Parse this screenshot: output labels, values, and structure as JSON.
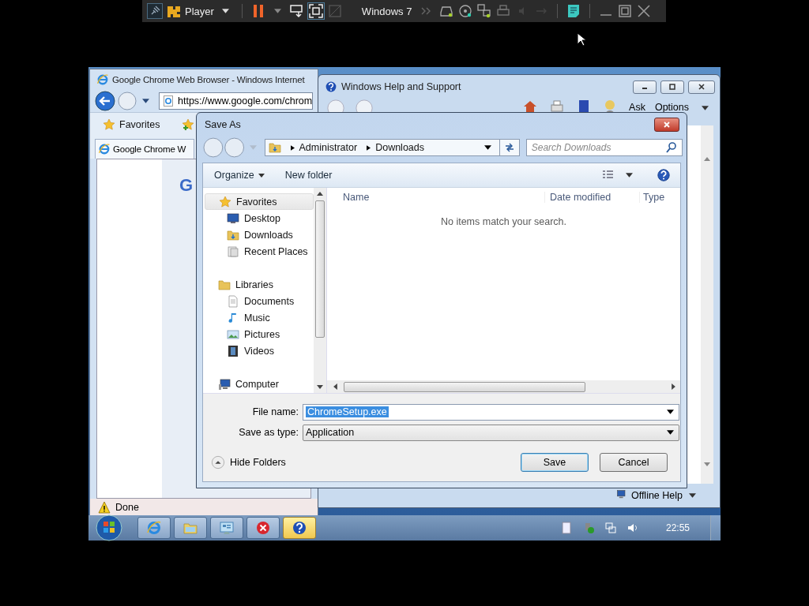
{
  "vm_toolbar": {
    "app_label": "Player",
    "vm_name": "Windows 7"
  },
  "browser_window": {
    "title": "Google Chrome Web Browser - Windows Internet",
    "address": "https://www.google.com/chrom",
    "favorites_label": "Favorites",
    "tab_label": "Google Chrome W",
    "page_text": "G",
    "status": "Done"
  },
  "help_window": {
    "title": "Windows Help and Support",
    "toolbar_labels": [
      "Ask",
      "Options"
    ],
    "footer_link": "Offline Help"
  },
  "save_dialog": {
    "title": "Save As",
    "breadcrumb": [
      "Administrator",
      "Downloads"
    ],
    "search": {
      "placeholder": "Search Downloads"
    },
    "toolbar": [
      "Organize",
      "New folder"
    ],
    "nav_groups": [
      {
        "label": "Favorites",
        "selected": true,
        "children": [
          {
            "label": "Desktop",
            "selected": false
          },
          {
            "label": "Downloads",
            "selected": false
          },
          {
            "label": "Recent Places",
            "selected": false
          }
        ]
      },
      {
        "label": "Libraries",
        "selected": false,
        "children": [
          {
            "label": "Documents",
            "selected": false
          },
          {
            "label": "Music",
            "selected": false
          },
          {
            "label": "Pictures",
            "selected": false
          },
          {
            "label": "Videos",
            "selected": false
          }
        ]
      },
      {
        "label": "Computer",
        "selected": false
      }
    ],
    "columns": [
      "Name",
      "Date modified",
      "Type"
    ],
    "empty_message": "No items match your search.",
    "file_name": {
      "label": "File name:",
      "value": "ChromeSetup.exe"
    },
    "save_type": {
      "label": "Save as type:",
      "value": "Application"
    },
    "hide_folders": "Hide Folders",
    "buttons": [
      {
        "label": "Save",
        "default": true
      },
      {
        "label": "Cancel",
        "default": false
      }
    ]
  },
  "taskbar": {
    "buttons": [
      {
        "selected": false
      },
      {
        "selected": false
      },
      {
        "selected": false
      },
      {
        "selected": false
      },
      {
        "selected": true
      }
    ],
    "clock": "22:55"
  }
}
